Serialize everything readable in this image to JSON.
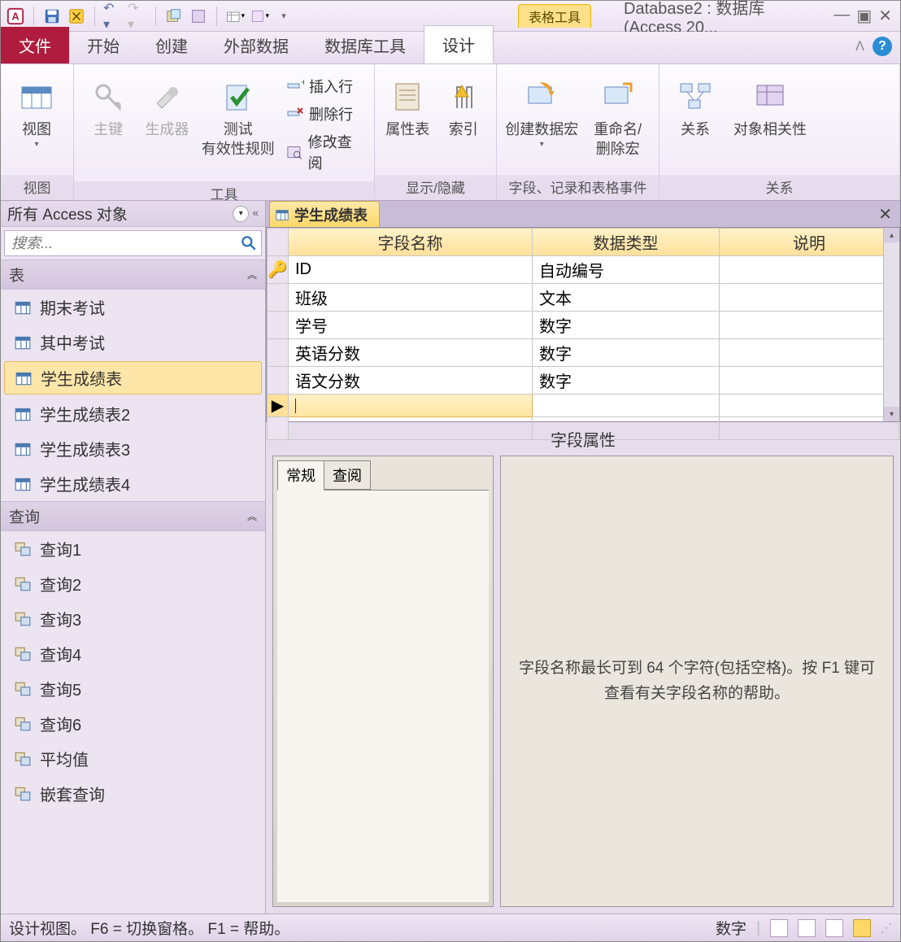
{
  "title": "Database2 : 数据库 (Access 20...",
  "contextual_tab": "表格工具",
  "tabs": {
    "file": "文件",
    "home": "开始",
    "create": "创建",
    "external": "外部数据",
    "dbtools": "数据库工具",
    "design": "设计"
  },
  "ribbon": {
    "g_view": {
      "view": "视图",
      "label": "视图"
    },
    "g_tools": {
      "pk": "主键",
      "builder": "生成器",
      "test": "测试\n有效性规则",
      "insert": "插入行",
      "delete": "删除行",
      "modify": "修改查阅",
      "label": "工具"
    },
    "g_show": {
      "prop": "属性表",
      "index": "索引",
      "label": "显示/隐藏"
    },
    "g_events": {
      "create": "创建数据宏",
      "rename": "重命名/\n删除宏",
      "label": "字段、记录和表格事件"
    },
    "g_rel": {
      "rel": "关系",
      "deps": "对象相关性",
      "label": "关系"
    }
  },
  "nav": {
    "title": "所有 Access 对象",
    "search_ph": "搜索...",
    "group_tables": "表",
    "group_queries": "查询",
    "tables": [
      "期末考试",
      "其中考试",
      "学生成绩表",
      "学生成绩表2",
      "学生成绩表3",
      "学生成绩表4"
    ],
    "queries": [
      "查询1",
      "查询2",
      "查询3",
      "查询4",
      "查询5",
      "查询6",
      "平均值",
      "嵌套查询"
    ]
  },
  "design": {
    "tab_title": "学生成绩表",
    "cols": {
      "name": "字段名称",
      "type": "数据类型",
      "desc": "说明"
    },
    "rows": [
      {
        "name": "ID",
        "type": "自动编号",
        "key": true
      },
      {
        "name": "班级",
        "type": "文本"
      },
      {
        "name": "学号",
        "type": "数字"
      },
      {
        "name": "英语分数",
        "type": "数字"
      },
      {
        "name": "语文分数",
        "type": "数字"
      }
    ],
    "prop_header": "字段属性",
    "prop_tabs": {
      "general": "常规",
      "lookup": "查阅"
    },
    "help_text": "字段名称最长可到 64 个字符(包括空格)。按 F1 键可查看有关字段名称的帮助。"
  },
  "status": {
    "left": "设计视图。   F6 = 切换窗格。   F1 = 帮助。",
    "mode": "数字"
  }
}
